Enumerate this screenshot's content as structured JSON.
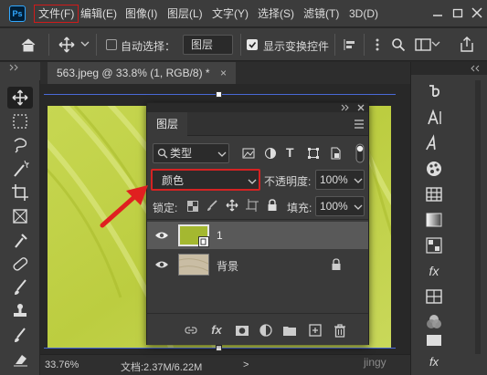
{
  "app": {
    "logo": "Ps"
  },
  "menu": [
    "文件(F)",
    "编辑(E)",
    "图像(I)",
    "图层(L)",
    "文字(Y)",
    "选择(S)",
    "滤镜(T)",
    "3D(D)"
  ],
  "options": {
    "auto_select_label": "自动选择：",
    "auto_select_target": "图层",
    "show_transform_label": "显示变换控件",
    "more": ">>"
  },
  "document": {
    "tab_title": "563.jpeg @ 33.8% (1, RGB/8) *",
    "tab_close": "×"
  },
  "status": {
    "zoom": "33.76%",
    "doc_info": "文档:2.37M/6.22M",
    "arrow": ">"
  },
  "layers_panel": {
    "title": "图层",
    "filter_label": "类型",
    "blend_mode": "颜色",
    "opacity_label": "不透明度:",
    "opacity_value": "100%",
    "lock_label": "锁定:",
    "fill_label": "填充:",
    "fill_value": "100%",
    "layers": [
      {
        "name": "1",
        "visible": true,
        "selected": true
      },
      {
        "name": "背景",
        "visible": true,
        "locked": true
      }
    ],
    "footer_fx": "fx"
  },
  "right_panel": {
    "fx_label": "fx"
  },
  "watermark": "jingy",
  "colors": {
    "accent_red": "#d42323",
    "layer_fill": "#a4b830",
    "canvas_texture": "#c4d44a",
    "frame_line": "#4a6ad8"
  }
}
